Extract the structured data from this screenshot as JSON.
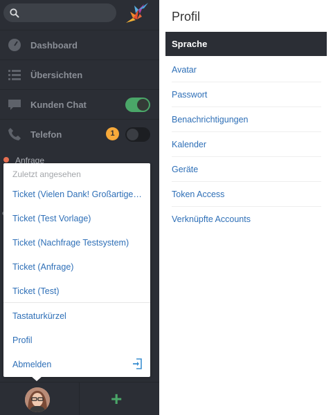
{
  "sidebar": {
    "search": {
      "placeholder": ""
    },
    "nav": [
      {
        "label": "Dashboard",
        "icon": "dashboard-icon"
      },
      {
        "label": "Übersichten",
        "icon": "list-icon"
      },
      {
        "label": "Kunden Chat",
        "icon": "chat-icon",
        "toggle": "on"
      },
      {
        "label": "Telefon",
        "icon": "phone-icon",
        "toggle": "off",
        "badge": "1"
      }
    ],
    "partial_item": "Anfrage"
  },
  "popup": {
    "heading": "Zuletzt angesehen",
    "recent": [
      "Ticket (Vielen Dank! Großartige…",
      "Ticket (Test Vorlage)",
      "Ticket (Nachfrage Testsystem)",
      "Ticket (Anfrage)",
      "Ticket (Test)"
    ],
    "actions": [
      "Tastaturkürzel",
      "Profil",
      "Abmelden"
    ]
  },
  "main": {
    "title": "Profil",
    "active": "Sprache",
    "menu": [
      "Avatar",
      "Passwort",
      "Benachrichtigungen",
      "Kalender",
      "Geräte",
      "Token Access",
      "Verknüpfte Accounts"
    ]
  },
  "colors": {
    "sidebar_bg": "#2b2e35",
    "accent_green": "#4aa668",
    "link_blue": "#2e6fb7",
    "badge_orange": "#f7a93a"
  }
}
